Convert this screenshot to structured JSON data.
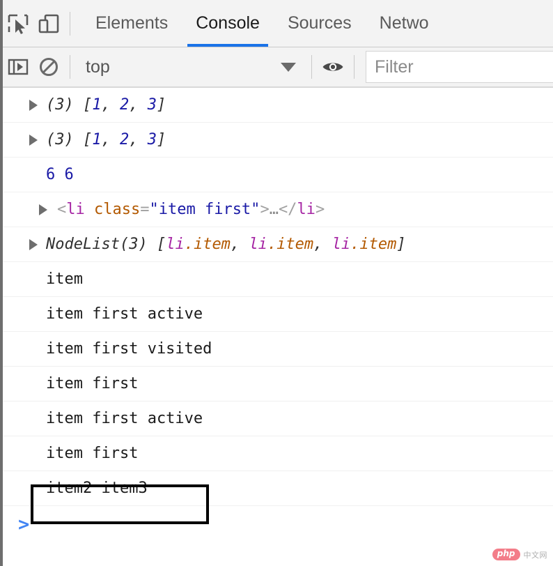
{
  "toolbar": {
    "inspect_icon": "inspect-element-icon",
    "device_icon": "device-toolbar-icon",
    "tabs": [
      {
        "label": "Elements",
        "active": false
      },
      {
        "label": "Console",
        "active": true
      },
      {
        "label": "Sources",
        "active": false
      },
      {
        "label": "Netwo",
        "active": false
      }
    ]
  },
  "filterbar": {
    "sidebar_icon": "console-sidebar-icon",
    "clear_icon": "clear-console-icon",
    "context_value": "top",
    "caret_icon": "chevron-down-icon",
    "eye_icon": "live-expression-eye-icon",
    "filter_placeholder": "Filter"
  },
  "console": {
    "messages": [
      {
        "id": "array-1",
        "kind": "array",
        "expandable": true,
        "count": "(3)",
        "open": " [",
        "values": [
          "1",
          "2",
          "3"
        ],
        "sep": ", ",
        "close": "]"
      },
      {
        "id": "array-2",
        "kind": "array",
        "expandable": true,
        "count": "(3)",
        "open": " [",
        "values": [
          "1",
          "2",
          "3"
        ],
        "sep": ", ",
        "close": "]"
      },
      {
        "id": "numbers",
        "kind": "numbers",
        "expandable": false,
        "text": "6 6"
      },
      {
        "id": "element",
        "kind": "html",
        "expandable": true,
        "open_bracket": "<",
        "tag": "li",
        "space": " ",
        "attr_name": "class",
        "equals": "=",
        "attr_value": "\"item first\"",
        "gt": ">",
        "ellipsis": "…",
        "close_open": "</",
        "close_tag": "li",
        "close_gt": ">"
      },
      {
        "id": "nodelist",
        "kind": "nodelist",
        "expandable": true,
        "label": "NodeList(3)",
        "open": " [",
        "items": [
          {
            "tag": "li",
            "cls": ".item"
          },
          {
            "tag": "li",
            "cls": ".item"
          },
          {
            "tag": "li",
            "cls": ".item"
          }
        ],
        "sep": ", ",
        "close": "]"
      },
      {
        "id": "t1",
        "kind": "text",
        "expandable": false,
        "text": "item"
      },
      {
        "id": "t2",
        "kind": "text",
        "expandable": false,
        "text": "item first active"
      },
      {
        "id": "t3",
        "kind": "text",
        "expandable": false,
        "text": "item first visited"
      },
      {
        "id": "t4",
        "kind": "text",
        "expandable": false,
        "text": "item first"
      },
      {
        "id": "t5",
        "kind": "text",
        "expandable": false,
        "text": "item first active"
      },
      {
        "id": "t6",
        "kind": "text",
        "expandable": false,
        "text": "item first"
      },
      {
        "id": "t7",
        "kind": "text",
        "expandable": false,
        "text": "item2 item3",
        "boxed": true
      }
    ],
    "prompt_symbol": ">"
  },
  "watermark": {
    "badge": "php",
    "text": "中文网"
  },
  "colors": {
    "accent": "#1a73e8",
    "prompt": "#4285f4",
    "number": "#1a1aa6",
    "tag": "#a626a4",
    "attr": "#b35900",
    "toolbar_bg": "#f3f3f3",
    "annotation": "#000000",
    "watermark_badge": "#f3737f"
  }
}
